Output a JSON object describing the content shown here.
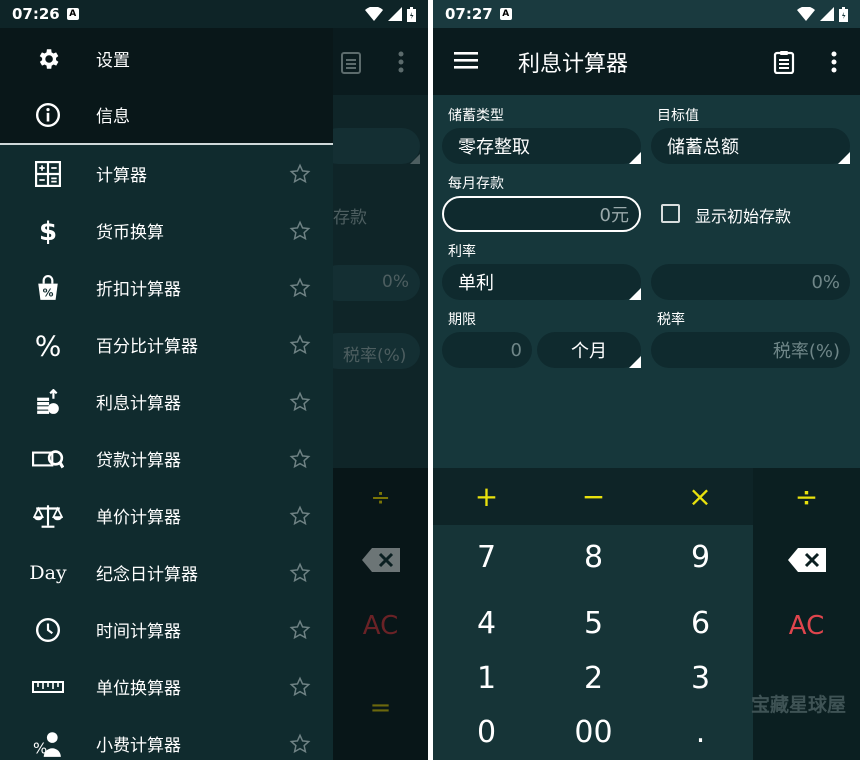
{
  "left": {
    "status": {
      "time": "07:26",
      "badge": "A"
    },
    "background_app": {
      "label_deposit": "存款",
      "rate_value": "0%",
      "tax_placeholder": "税率(%)",
      "side_keys": [
        "÷",
        "AC",
        "="
      ]
    },
    "drawer": {
      "top_items": [
        {
          "label": "设置",
          "icon": "gear-icon"
        },
        {
          "label": "信息",
          "icon": "info-icon"
        }
      ],
      "items": [
        {
          "label": "计算器",
          "icon": "calculator-icon"
        },
        {
          "label": "货币换算",
          "icon": "dollar-icon"
        },
        {
          "label": "折扣计算器",
          "icon": "discount-bag-icon"
        },
        {
          "label": "百分比计算器",
          "icon": "percent-icon"
        },
        {
          "label": "利息计算器",
          "icon": "interest-coins-icon"
        },
        {
          "label": "贷款计算器",
          "icon": "loan-icon"
        },
        {
          "label": "单价计算器",
          "icon": "scale-icon"
        },
        {
          "label": "纪念日计算器",
          "icon": "day-icon",
          "icon_text": "Day"
        },
        {
          "label": "时间计算器",
          "icon": "clock-icon"
        },
        {
          "label": "单位换算器",
          "icon": "ruler-icon"
        },
        {
          "label": "小费计算器",
          "icon": "tip-icon"
        }
      ]
    }
  },
  "right": {
    "status": {
      "time": "07:27",
      "badge": "A"
    },
    "toolbar": {
      "title": "利息计算器"
    },
    "form": {
      "savings_type_label": "储蓄类型",
      "savings_type_value": "零存整取",
      "target_label": "目标值",
      "target_value": "储蓄总额",
      "monthly_label": "每月存款",
      "monthly_value": "0元",
      "show_initial_label": "显示初始存款",
      "rate_label": "利率",
      "rate_type_value": "单利",
      "rate_value": "0%",
      "period_label": "期限",
      "period_value": "0",
      "period_unit": "个月",
      "tax_label": "税率",
      "tax_placeholder": "税率(%)"
    },
    "keypad": {
      "ops": [
        "+",
        "−",
        "×",
        "÷"
      ],
      "digits": [
        "7",
        "8",
        "9",
        "4",
        "5",
        "6",
        "1",
        "2",
        "3",
        "0",
        "00",
        "."
      ],
      "backspace": "backspace-icon",
      "clear": "AC"
    },
    "watermark": "宝藏星球屋"
  },
  "colors": {
    "accent_yellow": "#e8e10d",
    "clear_red": "#e0454d",
    "background": "#16373b"
  }
}
